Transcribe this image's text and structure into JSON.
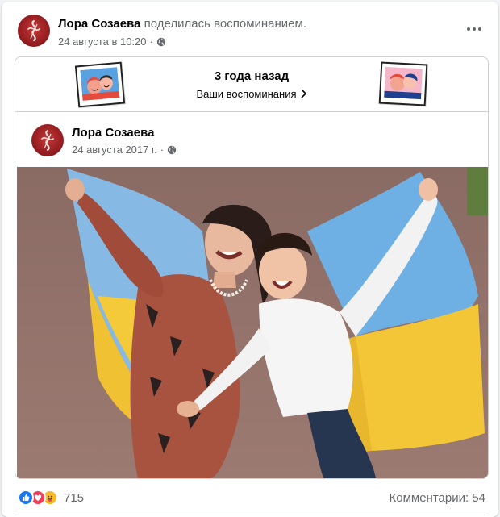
{
  "post": {
    "author_name": "Лора Созаева",
    "action_text": "поделилась воспоминанием.",
    "timestamp": "24 августа в 10:20",
    "separator": "·",
    "privacy_icon": "globe-icon",
    "more_icon": "more-horizontal-icon"
  },
  "memory": {
    "title": "3 года назад",
    "link_label": "Ваши воспоминания",
    "link_icon": "chevron-right-icon"
  },
  "shared_post": {
    "author_name": "Лора Созаева",
    "timestamp": "24 августа 2017 г.",
    "separator": "·",
    "privacy_icon": "globe-icon",
    "photo": "woman-and-boy-with-ukrainian-flag-photo"
  },
  "footer": {
    "reaction_icons": [
      "like-icon",
      "love-icon",
      "care-icon"
    ],
    "reaction_count": "715",
    "comments_label": "Комментарии: 54"
  },
  "colors": {
    "secondary_text": "#65676b",
    "like_blue": "#1877f2",
    "love_red": "#f33e58",
    "care_yellow": "#f7b928",
    "flag_blue": "#7eb3df",
    "flag_yellow": "#f2c637"
  }
}
